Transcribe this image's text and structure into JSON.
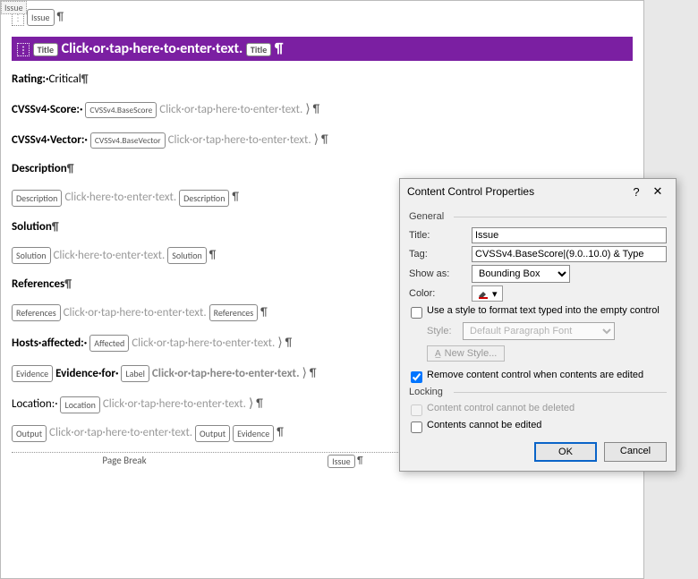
{
  "doc": {
    "topTag": "Issue",
    "firstTag": "Issue",
    "title": {
      "tagStart": "Title",
      "text": "Click·or·tap·here·to·enter·text.",
      "tagEnd": "Title"
    },
    "rating": {
      "label": "Rating",
      "value": "Critical"
    },
    "cvssScore": {
      "label": "CVSSv4·Score",
      "tag": "CVSSv4.BaseScore",
      "placeholder": "Click·or·tap·here·to·enter·text."
    },
    "cvssVector": {
      "label": "CVSSv4·Vector",
      "tag": "CVSSv4.BaseVector",
      "placeholder": "Click·or·tap·here·to·enter·text."
    },
    "description": {
      "heading": "Description",
      "tagStart": "Description",
      "placeholder": "Click·here·to·enter·text.",
      "tagEnd": "Description"
    },
    "solution": {
      "heading": "Solution",
      "tagStart": "Solution",
      "placeholder": "Click·here·to·enter·text.",
      "tagEnd": "Solution"
    },
    "references": {
      "heading": "References",
      "tagStart": "References",
      "placeholder": "Click·or·tap·here·to·enter·text.",
      "tagEnd": "References"
    },
    "hosts": {
      "label": "Hosts·affected:",
      "tag": "Affected",
      "placeholder": "Click·or·tap·here·to·enter·text."
    },
    "evidence": {
      "tagOuter": "Evidence",
      "label": "Evidence·for",
      "tagLabel": "Label",
      "placeholder": "Click·or·tap·here·to·enter·text."
    },
    "location": {
      "label": "Location:",
      "tag": "Location",
      "placeholder": "Click·or·tap·here·to·enter·text."
    },
    "output": {
      "tagStart": "Output",
      "placeholder": "Click·or·tap·here·to·enter·text.",
      "tagEnd": "Output",
      "tagOuterEnd": "Evidence"
    },
    "pageBreak": {
      "label": "Page Break",
      "tagEnd": "Issue"
    }
  },
  "dialog": {
    "title": "Content Control Properties",
    "help": "?",
    "close": "✕",
    "general": "General",
    "labels": {
      "title": "Title:",
      "tag": "Tag:",
      "showAs": "Show as:",
      "color": "Color:",
      "style": "Style:"
    },
    "values": {
      "title": "Issue",
      "tag": "CVSSv4.BaseScore|(9.0..10.0) & Type",
      "showAs": "Bounding Box",
      "style": "Default Paragraph Font"
    },
    "check1": "Use a style to format text typed into the empty control",
    "newStyle": "New Style...",
    "check2": "Remove content control when contents are edited",
    "locking": "Locking",
    "lock1": "Content control cannot be deleted",
    "lock2": "Contents cannot be edited",
    "ok": "OK",
    "cancel": "Cancel"
  }
}
